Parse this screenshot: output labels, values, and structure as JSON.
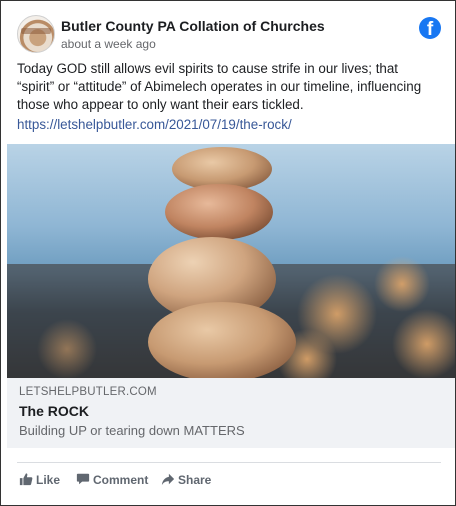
{
  "post": {
    "page_name": "Butler County PA Collation of Churches",
    "timestamp": "about a week ago",
    "text": "Today GOD still allows evil spirits to cause strife in our lives; that “spirit” or “attitude” of Abimelech operates in our timeline, influencing those who appear to only want their ears tickled.",
    "link": "https://letshelpbutler.com/2021/07/19/the-rock/",
    "platform_icon": "facebook-icon",
    "platform_icon_glyph": "f",
    "brand_color": "#1877f2"
  },
  "link_card": {
    "domain": "LETSHELPBUTLER.COM",
    "title": "The ROCK",
    "description": "Building UP or tearing down MATTERS",
    "image_icon": "stacked-rocks-photo"
  },
  "actions": {
    "like_label": "Like",
    "comment_label": "Comment",
    "share_label": "Share",
    "like_icon": "thumbs-up-icon",
    "comment_icon": "speech-bubble-icon",
    "share_icon": "share-arrow-icon"
  }
}
